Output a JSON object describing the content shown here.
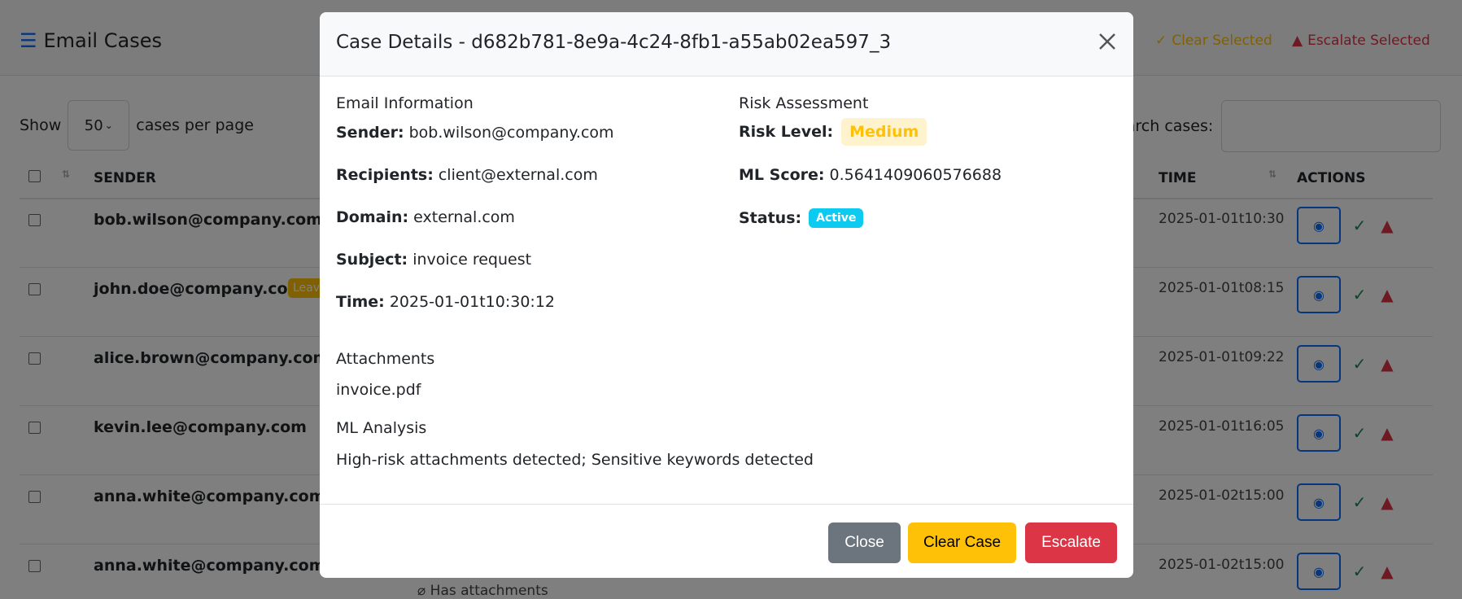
{
  "app": {
    "title": "Email Cases",
    "clear_selected": "Clear Selected",
    "escalate_selected": "Escalate Selected",
    "show_label": "Show",
    "page_size": "50",
    "per_page_label": "cases per page",
    "search_label": "Search cases:",
    "columns": [
      "SENDER",
      "TIME",
      "ACTIONS"
    ],
    "rows": [
      {
        "sender": "bob.wilson@company.com",
        "time": "2025-01-01t10:30"
      },
      {
        "sender": "john.doe@company.com",
        "badge": "Leaver",
        "time": "2025-01-01t08:15"
      },
      {
        "sender": "alice.brown@company.com",
        "time": "2025-01-01t09:22"
      },
      {
        "sender": "kevin.lee@company.com",
        "time": "2025-01-01t16:05"
      },
      {
        "sender": "anna.white@company.com",
        "time": "2025-01-02t15:00"
      },
      {
        "sender": "anna.white@company.com",
        "time": "2025-01-02t15:00"
      }
    ],
    "attachment_note": "Has attachments"
  },
  "modal": {
    "title": "Case Details - d682b781-8e9a-4c24-8fb1-a55ab02ea597_3",
    "email_info_heading": "Email Information",
    "sender_label": "Sender:",
    "sender": "bob.wilson@company.com",
    "recipients_label": "Recipients:",
    "recipients": "client@external.com",
    "domain_label": "Domain:",
    "domain": "external.com",
    "subject_label": "Subject:",
    "subject": "invoice request",
    "time_label": "Time:",
    "time": "2025-01-01t10:30:12",
    "risk_heading": "Risk Assessment",
    "risk_level_label": "Risk Level:",
    "risk_level": "Medium",
    "ml_score_label": "ML Score:",
    "ml_score": "0.5641409060576688",
    "status_label": "Status:",
    "status": "Active",
    "attachments_heading": "Attachments",
    "attachments": "invoice.pdf",
    "ml_heading": "ML Analysis",
    "ml_analysis": "High-risk attachments detected; Sensitive keywords detected",
    "close_button": "Close",
    "clear_button": "Clear Case",
    "escalate_button": "Escalate"
  },
  "colors": {
    "primary": "#0d6efd",
    "warning": "#ffc107",
    "danger": "#dc3545",
    "success": "#198754",
    "info": "#0dcaf0",
    "secondary": "#6c757d"
  }
}
